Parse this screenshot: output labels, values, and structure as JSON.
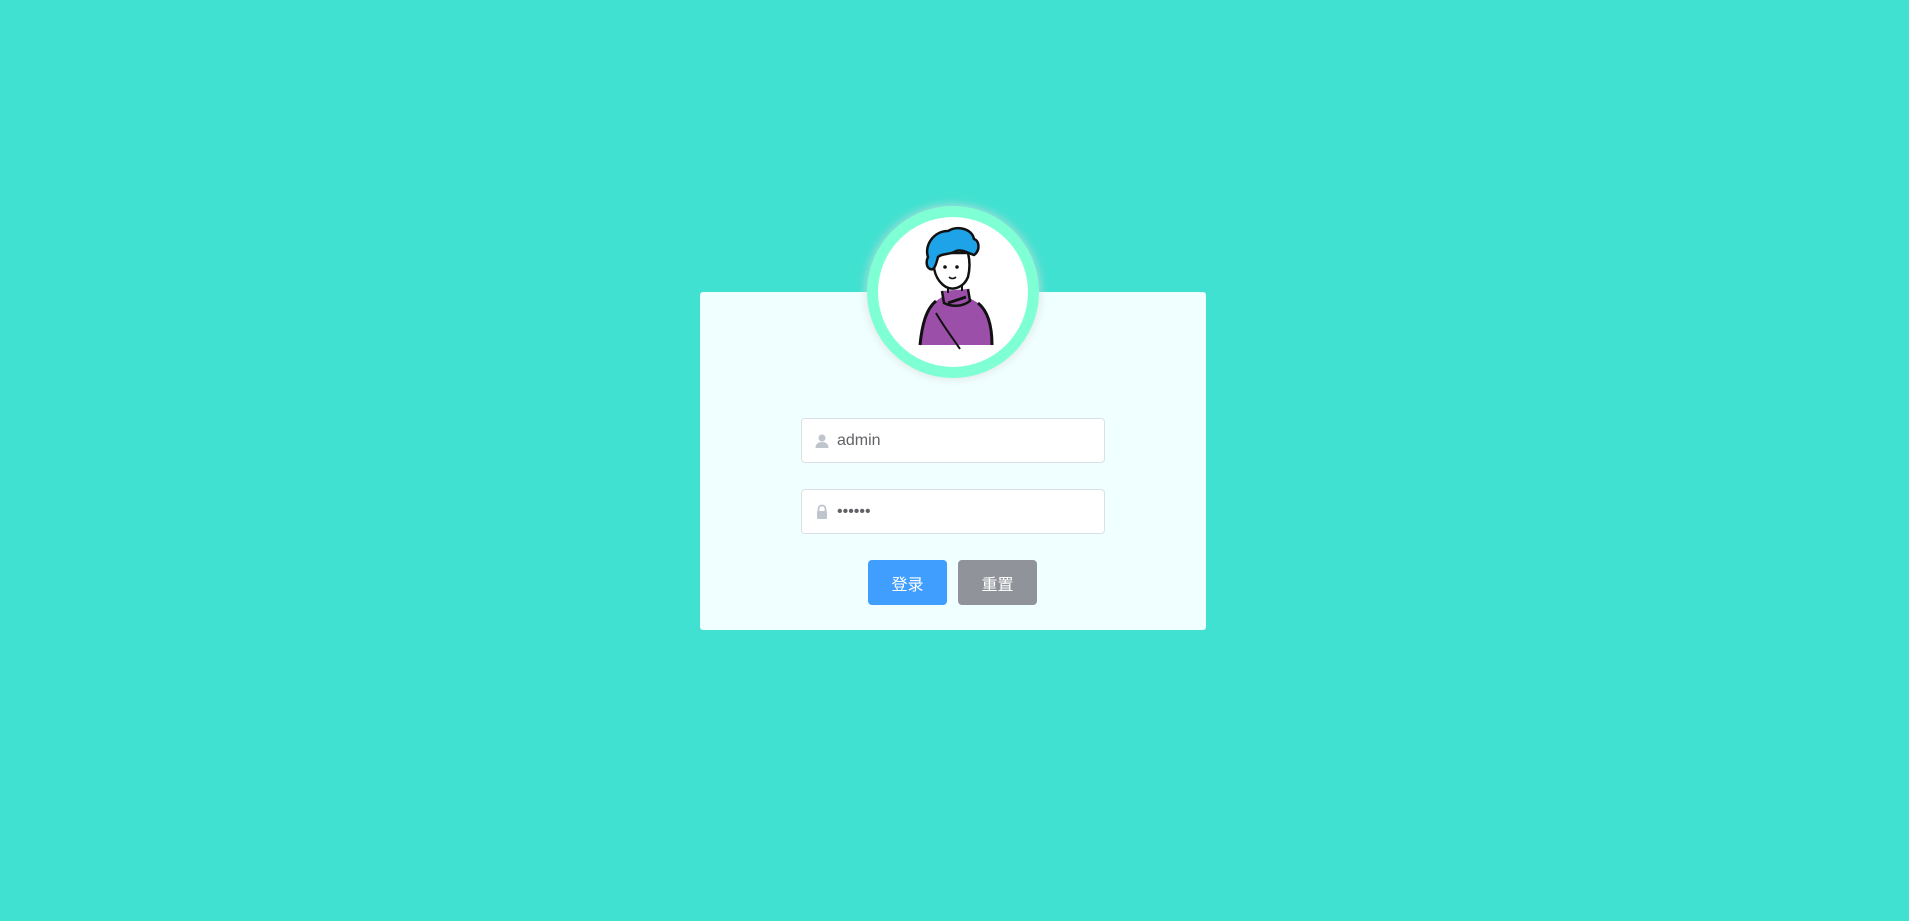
{
  "login_form": {
    "username": {
      "value": "admin",
      "icon": "user-icon"
    },
    "password": {
      "value": "••••••",
      "icon": "lock-icon"
    },
    "buttons": {
      "login_label": "登录",
      "reset_label": "重置"
    }
  },
  "colors": {
    "background": "#41e1d1",
    "card": "#f0ffff",
    "avatar_ring": "#7fffd4",
    "primary": "#409eff",
    "info": "#909399"
  }
}
